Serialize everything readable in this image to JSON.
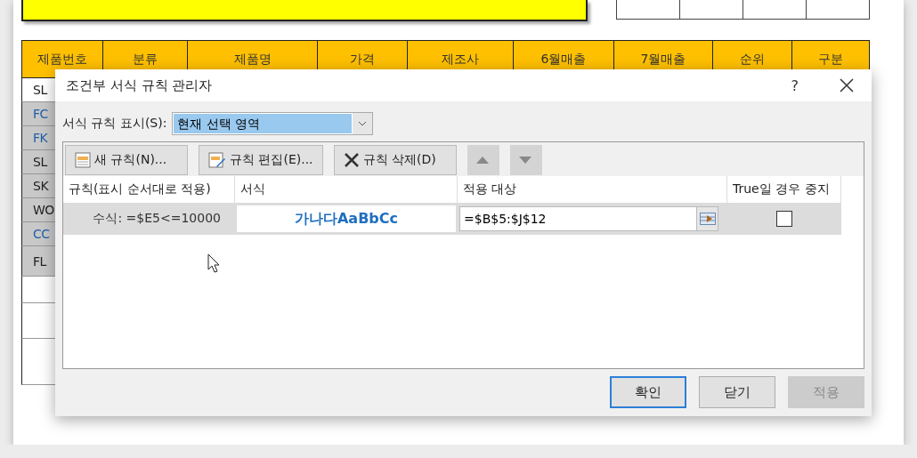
{
  "spreadsheet": {
    "header": [
      "제품번호",
      "분류",
      "제품명",
      "가격",
      "제조사",
      "6월매출",
      "7월매출",
      "순위",
      "구분"
    ],
    "rows": [
      {
        "label": "SL",
        "shaded": false,
        "color": "#222222"
      },
      {
        "label": "FC",
        "shaded": true,
        "color": "#1f5fa8"
      },
      {
        "label": "FK",
        "shaded": true,
        "color": "#1f5fa8"
      },
      {
        "label": "SL",
        "shaded": true,
        "color": "#222222"
      },
      {
        "label": "SK",
        "shaded": true,
        "color": "#222222"
      },
      {
        "label": "WO",
        "shaded": true,
        "color": "#222222"
      },
      {
        "label": "CC",
        "shaded": true,
        "color": "#1f5fa8"
      },
      {
        "label": "FL",
        "shaded": true,
        "color": "#222222"
      }
    ]
  },
  "dialog": {
    "title": "조건부 서식 규칙 관리자",
    "help": "?",
    "show_rules": {
      "label": "서식 규칙 표시(S):",
      "value": "현재 선택 영역"
    },
    "toolbar": [
      {
        "kind": "new",
        "label": "새 규칙(N)...",
        "disabled": false
      },
      {
        "kind": "edit",
        "label": "규칙 편집(E)...",
        "disabled": false
      },
      {
        "kind": "delete",
        "label": "규칙 삭제(D)",
        "disabled": false
      },
      {
        "kind": "up",
        "disabled": true
      },
      {
        "kind": "down",
        "disabled": true
      }
    ],
    "columns": [
      "규칙(표시 순서대로 적용)",
      "서식",
      "적용 대상",
      "True일 경우 중지"
    ],
    "rules": [
      {
        "condition": "수식: =$E5<=10000",
        "preview": "가나다AaBbCc",
        "applies_to": "=$B$5:$J$12",
        "stop_if_true": false,
        "selected": true
      }
    ],
    "buttons": [
      {
        "label": "확인",
        "default": true,
        "disabled": false
      },
      {
        "label": "닫기",
        "default": false,
        "disabled": false
      },
      {
        "label": "적용",
        "default": false,
        "disabled": true
      }
    ]
  }
}
